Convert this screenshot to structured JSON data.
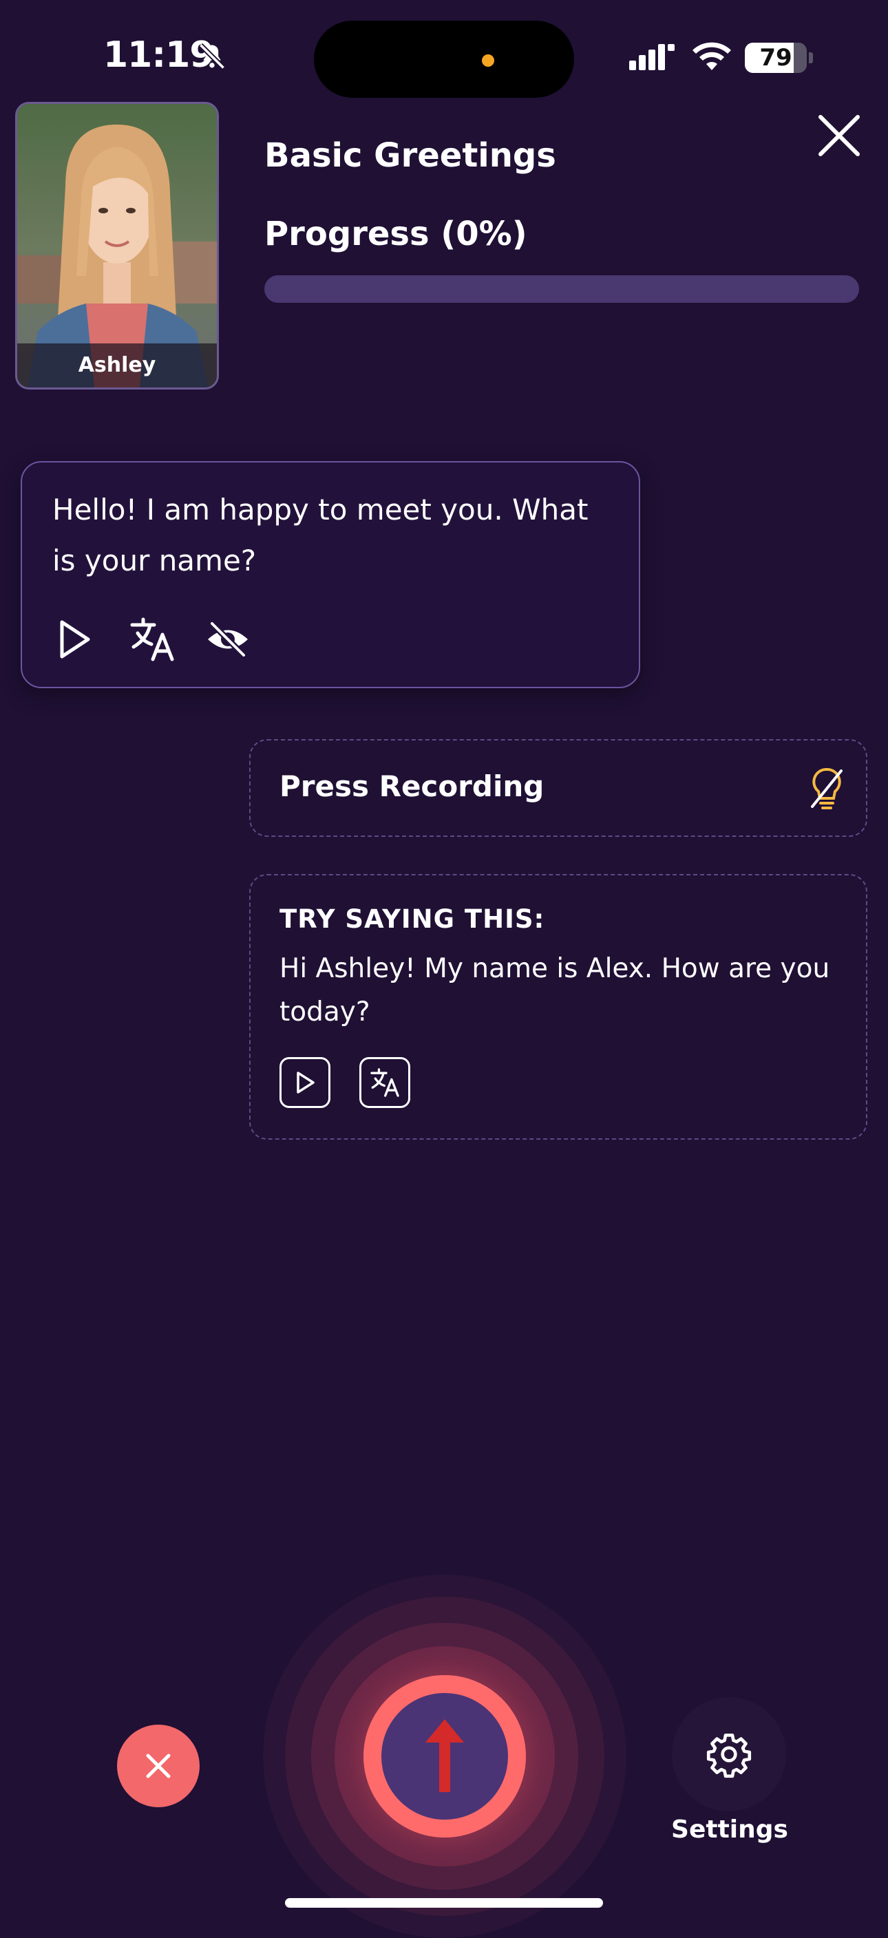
{
  "status_bar": {
    "time": "11:19",
    "battery_level": "79",
    "battery_fraction": 0.79,
    "icons": [
      "bell-slash-icon",
      "cellular-signal-icon",
      "wifi-icon",
      "battery-icon"
    ]
  },
  "character": {
    "name": "Ashley"
  },
  "lesson": {
    "title": "Basic Greetings",
    "progress_label": "Progress (0%)",
    "progress_fraction": 0
  },
  "message": {
    "text": "Hello! I am happy to meet you. What is your name?",
    "actions": [
      "play-icon",
      "translate-icon",
      "hide-text-icon"
    ]
  },
  "prompt": {
    "press_text": "Press Recording",
    "hint_icon": "lightbulb-off-icon"
  },
  "suggestion": {
    "title": "TRY SAYING THIS:",
    "text": "Hi Ashley! My name is Alex. How are you today?",
    "actions": [
      "play-icon",
      "translate-icon"
    ]
  },
  "controls": {
    "cancel_icon": "close-icon",
    "record_icon": "arrow-up-icon",
    "settings_label": "Settings",
    "settings_icon": "gear-icon"
  },
  "colors": {
    "background": "#1f1034",
    "accent": "#ff6b6b",
    "progress_track": "#4a3870",
    "hint_bulb": "#f5b942"
  }
}
